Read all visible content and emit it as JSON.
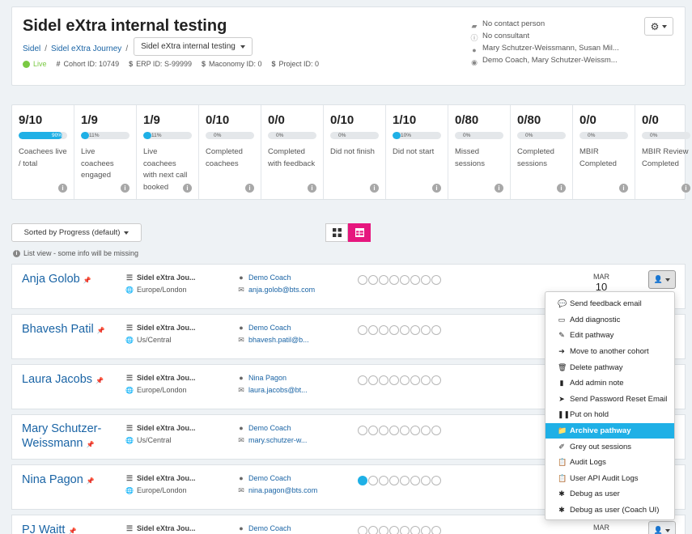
{
  "header": {
    "title": "Sidel eXtra internal testing",
    "breadcrumb": [
      "Sidel",
      "Sidel eXtra Journey"
    ],
    "breadcrumb_select": "Sidel eXtra internal testing",
    "status": "Live",
    "cohort_id": "Cohort ID: 10749",
    "erp_id": "ERP ID: S-99999",
    "maconomy_id": "Maconomy ID: 0",
    "project_id": "Project ID: 0",
    "contact": "No contact person",
    "consultant": "No consultant",
    "admins": "Mary Schutzer-Weissmann, Susan Mil...",
    "coaches": "Demo Coach, Mary Schutzer-Weissm..."
  },
  "stats": [
    {
      "value": "9/10",
      "pct": "90%",
      "progress": 0.9,
      "label": "Coachees live / total"
    },
    {
      "value": "1/9",
      "pct": "11%",
      "progress": 0.11,
      "label": "Live coachees engaged"
    },
    {
      "value": "1/9",
      "pct": "11%",
      "progress": 0.11,
      "label": "Live coachees with next call booked"
    },
    {
      "value": "0/10",
      "pct": "0%",
      "progress": 0,
      "label": "Completed coachees"
    },
    {
      "value": "0/0",
      "pct": "0%",
      "progress": 0,
      "label": "Completed with feedback"
    },
    {
      "value": "0/10",
      "pct": "0%",
      "progress": 0,
      "label": "Did not finish"
    },
    {
      "value": "1/10",
      "pct": "10%",
      "progress": 0.1,
      "label": "Did not start"
    },
    {
      "value": "0/80",
      "pct": "0%",
      "progress": 0,
      "label": "Missed sessions"
    },
    {
      "value": "0/80",
      "pct": "0%",
      "progress": 0,
      "label": "Completed sessions"
    },
    {
      "value": "0/0",
      "pct": "0%",
      "progress": 0,
      "label": "MBIR Completed"
    },
    {
      "value": "0/0",
      "pct": "0%",
      "progress": 0,
      "label": "MBIR Review Completed"
    }
  ],
  "controls": {
    "sort_label": "Sorted by Progress (default)",
    "list_note": "List view - some info will be missing"
  },
  "coachees": [
    {
      "name": "Anja Golob",
      "journey": "Sidel eXtra Jou...",
      "tz": "Europe/London",
      "coach": "Demo Coach",
      "email": "anja.golob@bts.com",
      "progress": 0,
      "mon": "MAR",
      "day": "10"
    },
    {
      "name": "Bhavesh Patil",
      "journey": "Sidel eXtra Jou...",
      "tz": "Us/Central",
      "coach": "Demo Coach",
      "email": "bhavesh.patil@b...",
      "progress": 0
    },
    {
      "name": "Laura Jacobs",
      "journey": "Sidel eXtra Jou...",
      "tz": "Europe/London",
      "coach": "Nina Pagon",
      "email": "laura.jacobs@bt...",
      "progress": 0
    },
    {
      "name": "Mary Schutzer-Weissmann",
      "journey": "Sidel eXtra Jou...",
      "tz": "Us/Central",
      "coach": "Demo Coach",
      "email": "mary.schutzer-w...",
      "progress": 0
    },
    {
      "name": "Nina Pagon",
      "journey": "Sidel eXtra Jou...",
      "tz": "Europe/London",
      "coach": "Demo Coach",
      "email": "nina.pagon@bts.com",
      "progress": 1
    },
    {
      "name": "PJ Waitt",
      "journey": "Sidel eXtra Jou...",
      "tz": "",
      "coach": "Demo Coach",
      "email": "",
      "progress": 0,
      "mon": "MAR",
      "day": ""
    }
  ],
  "menu": [
    {
      "label": "Send feedback email",
      "icon": "comment-icon"
    },
    {
      "label": "Add diagnostic",
      "icon": "inbox-icon"
    },
    {
      "label": "Edit pathway",
      "icon": "edit-icon"
    },
    {
      "label": "Move to another cohort",
      "icon": "arrow-right-icon"
    },
    {
      "label": "Delete pathway",
      "icon": "trash-icon"
    },
    {
      "label": "Add admin note",
      "icon": "file-icon"
    },
    {
      "label": "Send Password Reset Email",
      "icon": "paper-plane-icon"
    },
    {
      "label": "Put on hold",
      "icon": "pause-icon"
    },
    {
      "label": "Archive pathway",
      "icon": "folder-icon",
      "active": true
    },
    {
      "label": "Grey out sessions",
      "icon": "eraser-icon"
    },
    {
      "label": "Audit Logs",
      "icon": "clipboard-icon"
    },
    {
      "label": "User API Audit Logs",
      "icon": "clipboard-icon"
    },
    {
      "label": "Debug as user",
      "icon": "bug-icon"
    },
    {
      "label": "Debug as user (Coach UI)",
      "icon": "bug-icon"
    }
  ],
  "colors": {
    "accent": "#1fb0e6",
    "pink": "#e6177e",
    "link": "#1a64a5",
    "live": "#7ac943"
  }
}
